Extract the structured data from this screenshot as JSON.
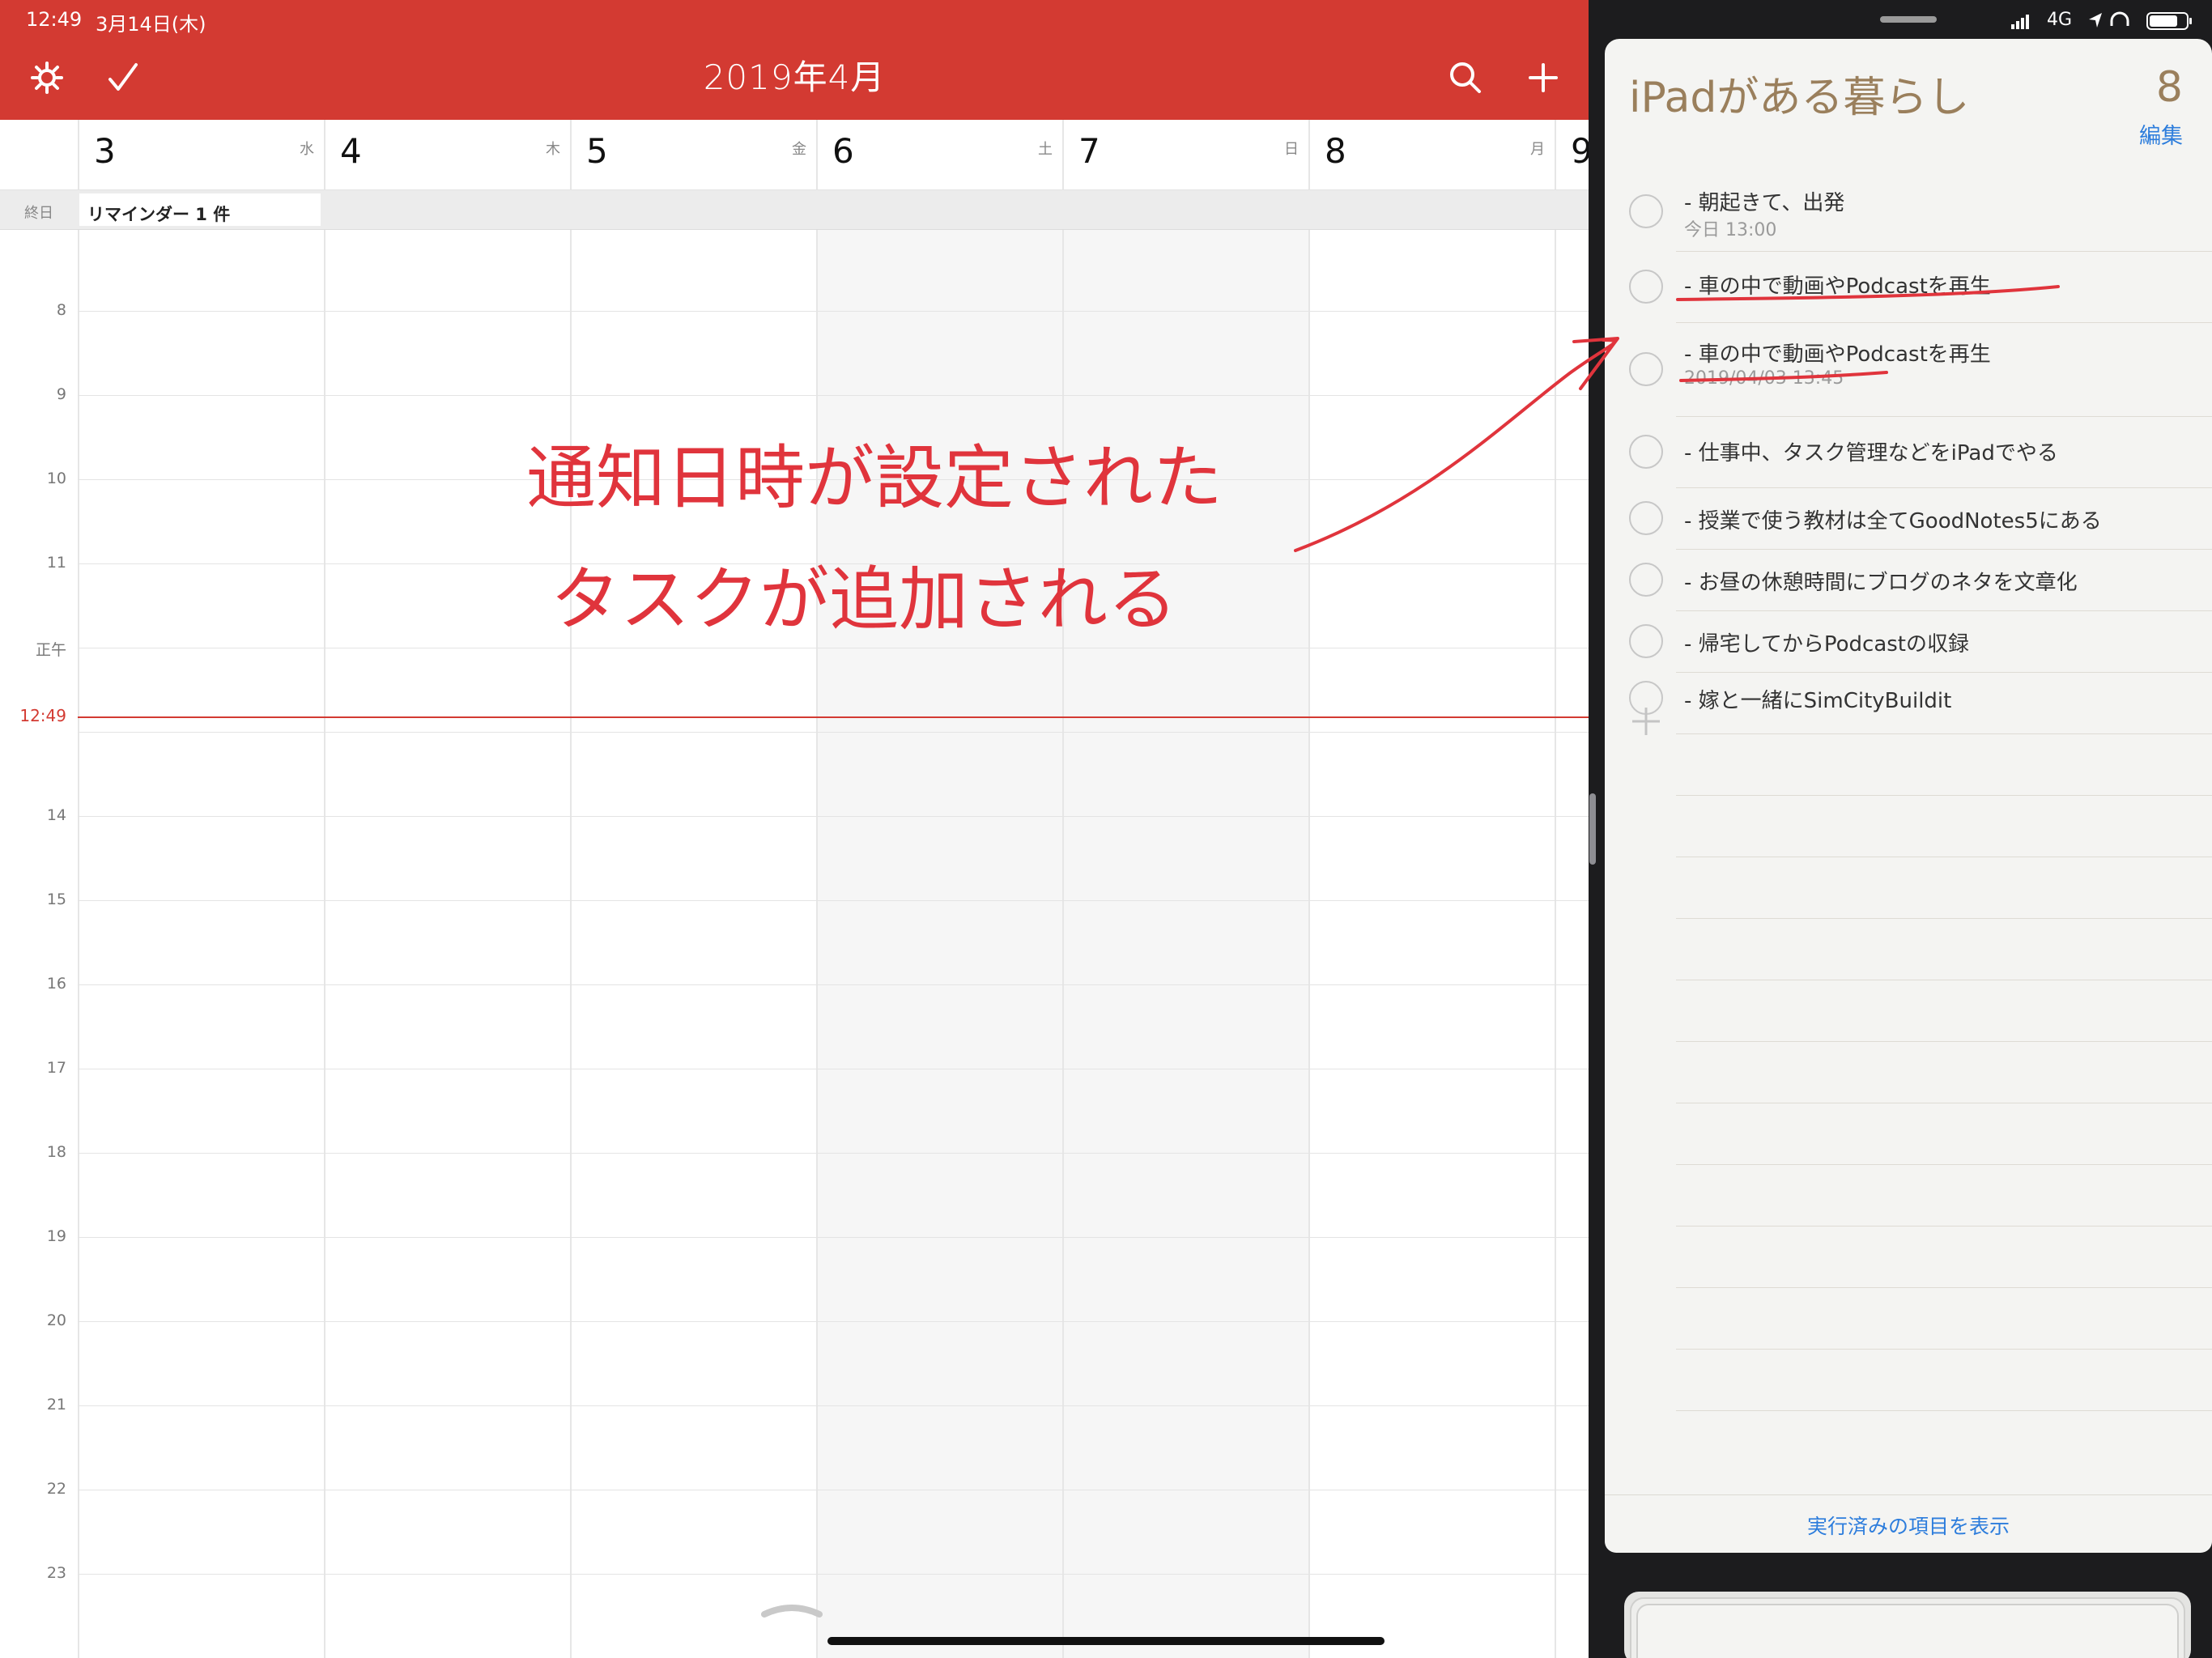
{
  "status_bar": {
    "time": "12:49",
    "date": "3月14日(木)",
    "network": "4G"
  },
  "calendar": {
    "month_title": "2019年4月",
    "days": [
      {
        "num": "3",
        "weekday": "水"
      },
      {
        "num": "4",
        "weekday": "木"
      },
      {
        "num": "5",
        "weekday": "金"
      },
      {
        "num": "6",
        "weekday": "土"
      },
      {
        "num": "7",
        "weekday": "日"
      },
      {
        "num": "8",
        "weekday": "月"
      },
      {
        "num": "9",
        "weekday": ""
      }
    ],
    "allday_label": "終日",
    "allday_event": "リマインダー 1 件",
    "hours": [
      "8",
      "9",
      "10",
      "11",
      "正午",
      "14",
      "15",
      "16",
      "17",
      "18",
      "19",
      "20",
      "21",
      "22",
      "23"
    ],
    "now_label": "12:49"
  },
  "reminders": {
    "list_title": "iPadがある暮らし",
    "count": "8",
    "edit_label": "編集",
    "items": [
      {
        "text": "- 朝起きて、出発",
        "sub": "今日 13:00"
      },
      {
        "text": "- 車の中で動画やPodcastを再生",
        "sub": ""
      },
      {
        "text": "- 車の中で動画やPodcastを再生",
        "sub": "2019/04/03 13:45"
      },
      {
        "text": "- 仕事中、タスク管理などをiPadでやる",
        "sub": ""
      },
      {
        "text": "- 授業で使う教材は全てGoodNotes5にある",
        "sub": ""
      },
      {
        "text": "- お昼の休憩時間にブログのネタを文章化",
        "sub": ""
      },
      {
        "text": "- 帰宅してからPodcastの収録",
        "sub": ""
      },
      {
        "text": "- 嫁と一緒にSimCityBuildit",
        "sub": ""
      }
    ],
    "show_completed": "実行済みの項目を表示"
  },
  "annotation": {
    "line1": "通知日時が設定された",
    "line2": "タスクが追加される",
    "ink_color": "#e0343c"
  }
}
